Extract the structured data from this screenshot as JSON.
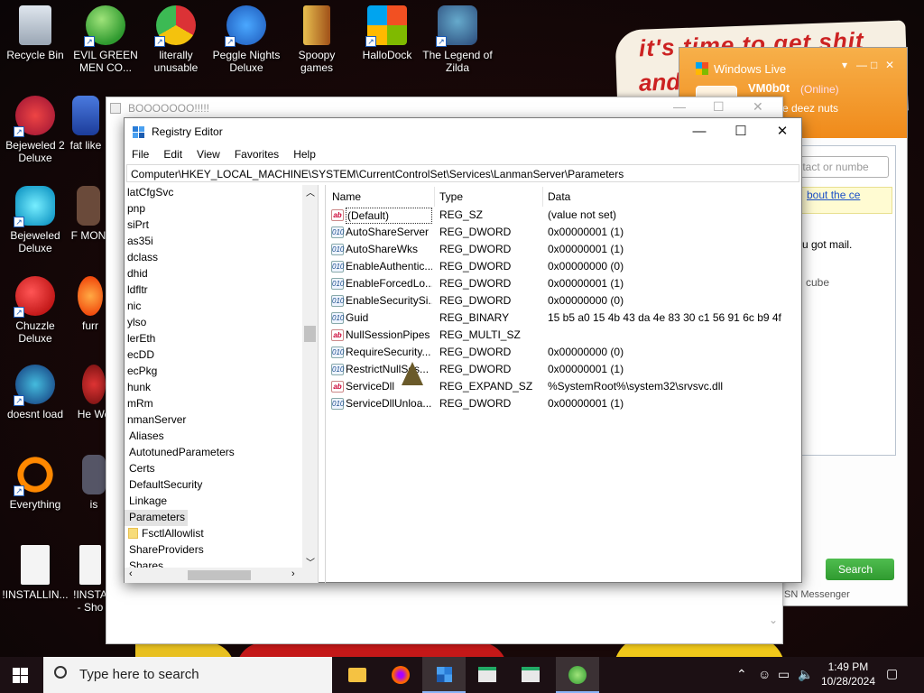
{
  "desktop": {
    "art_text_1": "it's time to get shit",
    "art_text_2": "and",
    "icons": [
      {
        "label": "Recycle Bin"
      },
      {
        "label": "EVIL GREEN MEN CO..."
      },
      {
        "label": "literally unusable"
      },
      {
        "label": "Peggle Nights Deluxe"
      },
      {
        "label": "Spoopy games"
      },
      {
        "label": "HalloDock"
      },
      {
        "label": "The Legend of Zilda"
      },
      {
        "label": "Bejeweled 2 Deluxe"
      },
      {
        "label": "fat like"
      },
      {
        "label": "Bejeweled Deluxe"
      },
      {
        "label": "F MON"
      },
      {
        "label": "Chuzzle Deluxe"
      },
      {
        "label": "furr"
      },
      {
        "label": "doesnt load"
      },
      {
        "label": "He We"
      },
      {
        "label": "Everything"
      },
      {
        "label": "is"
      },
      {
        "label": "!INSTALLIN..."
      },
      {
        "label": "!INSTA - Sho"
      }
    ]
  },
  "msn": {
    "title": "Windows Live",
    "username": "VM0b0t",
    "status": "(Online)",
    "personal_message": "rate deez nuts",
    "search_placeholder": "contact or numbe",
    "link_text": "bout the ce",
    "mail_text": "u got mail.",
    "cube_text": "cube",
    "search_button": "Search",
    "footer": "SN Messenger"
  },
  "boo_window": {
    "title": "BOOOOOOO!!!!!"
  },
  "regedit": {
    "title": "Registry Editor",
    "menu": [
      "File",
      "Edit",
      "View",
      "Favorites",
      "Help"
    ],
    "address": "Computer\\HKEY_LOCAL_MACHINE\\SYSTEM\\CurrentControlSet\\Services\\LanmanServer\\Parameters",
    "tree": [
      {
        "label": "latCfgSvc"
      },
      {
        "label": "pnp"
      },
      {
        "label": "siPrt"
      },
      {
        "label": "as35i"
      },
      {
        "label": "dclass"
      },
      {
        "label": "dhid"
      },
      {
        "label": "ldfltr"
      },
      {
        "label": "nic"
      },
      {
        "label": "ylso"
      },
      {
        "label": "lerEth"
      },
      {
        "label": "ecDD"
      },
      {
        "label": "ecPkg"
      },
      {
        "label": "hunk"
      },
      {
        "label": "mRm"
      },
      {
        "label": "nmanServer"
      },
      {
        "label": "Aliases"
      },
      {
        "label": "AutotunedParameters"
      },
      {
        "label": "Certs"
      },
      {
        "label": "DefaultSecurity"
      },
      {
        "label": "Linkage"
      },
      {
        "label": "Parameters"
      },
      {
        "label": "FsctlAllowlist"
      },
      {
        "label": "ShareProviders"
      },
      {
        "label": "Shares"
      }
    ],
    "columns": {
      "name": "Name",
      "type": "Type",
      "data": "Data"
    },
    "values": [
      {
        "name": "(Default)",
        "type": "REG_SZ",
        "data": "(value not set)",
        "icon": "string-value-icon"
      },
      {
        "name": "AutoShareServer",
        "type": "REG_DWORD",
        "data": "0x00000001 (1)",
        "icon": "binary-value-icon"
      },
      {
        "name": "AutoShareWks",
        "type": "REG_DWORD",
        "data": "0x00000001 (1)",
        "icon": "binary-value-icon"
      },
      {
        "name": "EnableAuthentic...",
        "type": "REG_DWORD",
        "data": "0x00000000 (0)",
        "icon": "binary-value-icon"
      },
      {
        "name": "EnableForcedLo...",
        "type": "REG_DWORD",
        "data": "0x00000001 (1)",
        "icon": "binary-value-icon"
      },
      {
        "name": "EnableSecuritySi...",
        "type": "REG_DWORD",
        "data": "0x00000000 (0)",
        "icon": "binary-value-icon"
      },
      {
        "name": "Guid",
        "type": "REG_BINARY",
        "data": "15 b5 a0 15 4b 43 da 4e 83 30 c1 56 91 6c b9 4f",
        "icon": "binary-value-icon"
      },
      {
        "name": "NullSessionPipes",
        "type": "REG_MULTI_SZ",
        "data": "",
        "icon": "string-value-icon"
      },
      {
        "name": "RequireSecurity...",
        "type": "REG_DWORD",
        "data": "0x00000000 (0)",
        "icon": "binary-value-icon"
      },
      {
        "name": "RestrictNullSes...",
        "type": "REG_DWORD",
        "data": "0x00000001 (1)",
        "icon": "binary-value-icon"
      },
      {
        "name": "ServiceDll",
        "type": "REG_EXPAND_SZ",
        "data": "%SystemRoot%\\system32\\srvsvc.dll",
        "icon": "string-value-icon"
      },
      {
        "name": "ServiceDllUnloa...",
        "type": "REG_DWORD",
        "data": "0x00000001 (1)",
        "icon": "binary-value-icon"
      }
    ]
  },
  "taskbar": {
    "search_placeholder": "Type here to search",
    "time": "1:49 PM",
    "date": "10/28/2024"
  }
}
